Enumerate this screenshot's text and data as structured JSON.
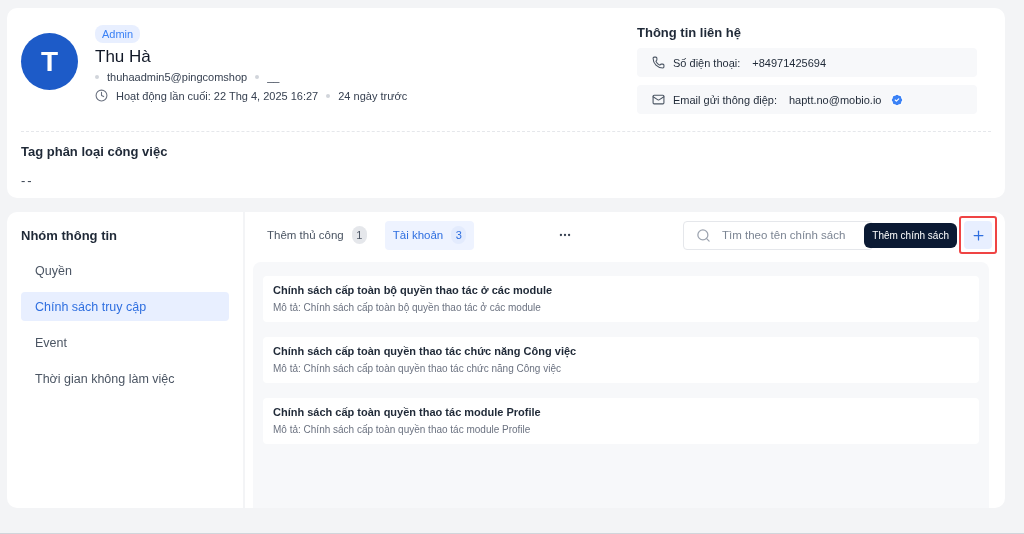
{
  "profile": {
    "role": "Admin",
    "initial": "T",
    "name": "Thu Hà",
    "username": "thuhaadmin5@pingcomshop",
    "extra": "__",
    "last_active": "Hoạt động lần cuối: 22 Thg 4, 2025 16:27",
    "relative": "24 ngày trước"
  },
  "contact": {
    "title": "Thông tin liên hệ",
    "items": [
      {
        "kind": "phone",
        "label": "Số điện thoại:",
        "value": "+84971425694",
        "verified": false
      },
      {
        "kind": "email",
        "label": "Email gửi thông điệp:",
        "value": "haptt.no@mobio.io",
        "verified": true
      }
    ]
  },
  "tags": {
    "title": "Tag phân loại công việc",
    "value": "--"
  },
  "sidebar": {
    "title": "Nhóm thông tin",
    "items": [
      {
        "label": "Quyền",
        "selected": false
      },
      {
        "label": "Chính sách truy cập",
        "selected": true
      },
      {
        "label": "Event",
        "selected": false
      },
      {
        "label": "Thời gian không làm việc",
        "selected": false
      }
    ]
  },
  "tabs": [
    {
      "label": "Thêm thủ công",
      "count": "1",
      "selected": false
    },
    {
      "label": "Tài khoản",
      "count": "3",
      "selected": true
    }
  ],
  "search": {
    "placeholder": "Tìm theo tên chính sách"
  },
  "add_button": {
    "tooltip": "Thêm chính sách",
    "highlighted": true
  },
  "policies": [
    {
      "title": "Chính sách cấp toàn bộ quyền thao tác ở các module",
      "description": "Mô tả: Chính sách cấp toàn bộ quyền thao tác ở các module"
    },
    {
      "title": "Chính sách cấp toàn quyền thao tác chức năng Công việc",
      "description": "Mô tả: Chính sách cấp toàn quyền thao tác chức năng Công việc"
    },
    {
      "title": "Chính sách cấp toàn quyền thao tác module Profile",
      "description": "Mô tả: Chính sách cấp toàn quyền thao tác module Profile"
    }
  ]
}
